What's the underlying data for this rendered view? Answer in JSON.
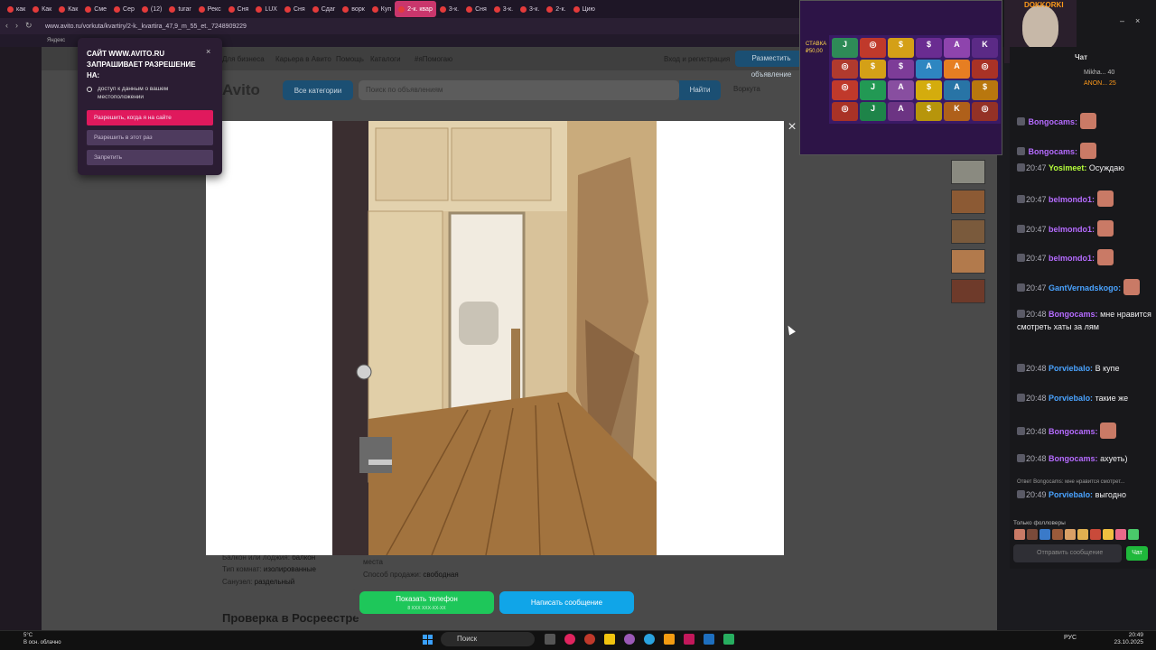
{
  "browser": {
    "tabs": [
      "как",
      "Как",
      "Как",
      "Сме",
      "Сер",
      "(12)",
      "turar",
      "Рекс",
      "Сня",
      "LUX",
      "Сня",
      "Сдаг",
      "ворк",
      "Куп",
      "2-к. квар",
      "3-к.",
      "Сня",
      "3-к.",
      "3-к.",
      "2-к.",
      "Цию"
    ],
    "active_tab_index": 14,
    "url": "www.avito.ru/vorkuta/kvartiry/2-k._kvartira_47,9_m_55_et._7248909229",
    "bookmark": "Яндекс"
  },
  "permission_popup": {
    "title": "САЙТ WWW.AVITO.RU ЗАПРАШИВАЕТ РАЗРЕШЕНИЕ НА:",
    "item": "доступ к данным о вашем местоположении",
    "allow_always": "Разрешить, когда я на сайте",
    "allow_once": "Разрешить в этот раз",
    "deny": "Запретить"
  },
  "avito": {
    "nav_business": "Для бизнеса",
    "nav_career": "Карьера в Авито",
    "nav_help": "Помощь",
    "nav_catalogs": "Каталоги",
    "nav_tag": "#яПомогаю",
    "login": "Вход и регистрация",
    "post_button": "Разместить объявление",
    "logo": "Avito",
    "categories_button": "Все категории",
    "search_placeholder": "Поиск по объявлениям",
    "find_button": "Найти",
    "city": "Воркута",
    "balcony_label": "Балкон или лоджия:",
    "balcony_value": "балкон",
    "rooms_type_label": "Тип комнат:",
    "rooms_type_value": "изолированные",
    "bathroom_label": "Санузел:",
    "bathroom_value": "раздельный",
    "places_label": "места",
    "sale_label": "Способ продажи:",
    "sale_value": "свободная",
    "section_title": "Проверка в Росреестре",
    "show_phone": "Показать телефон",
    "phone_sub": "8 XXX XXX-XX-XX",
    "write_message": "Написать сообщение"
  },
  "stream": {
    "streamer": "DOKKORKI",
    "chat_title": "Чат",
    "viewers": [
      {
        "name": "Mikha...",
        "count": "40"
      },
      {
        "name": "ANON...",
        "count": "25"
      }
    ],
    "slot_bet_label": "СТАВКА",
    "slot_bet_value": "₽50,00"
  },
  "chat": {
    "messages": [
      {
        "time": "",
        "user": "Bongocams:",
        "text": "",
        "ucolor": "violet"
      },
      {
        "time": "",
        "user": "Bongocams:",
        "text": "",
        "ucolor": "violet"
      },
      {
        "time": "20:47",
        "user": "Yosimeet:",
        "text": "Осуждаю",
        "ucolor": "green"
      },
      {
        "time": "20:47",
        "user": "belmondo1:",
        "text": "",
        "ucolor": "violet"
      },
      {
        "time": "20:47",
        "user": "belmondo1:",
        "text": "",
        "ucolor": "violet"
      },
      {
        "time": "20:47",
        "user": "belmondo1:",
        "text": "",
        "ucolor": "violet"
      },
      {
        "time": "20:47",
        "user": "GantVernadskogo:",
        "text": "",
        "ucolor": "blue"
      },
      {
        "time": "20:48",
        "user": "Bongocams:",
        "text": "мне нравится смотреть хаты за лям",
        "ucolor": "violet"
      },
      {
        "time": "20:48",
        "user": "Porviebalo:",
        "text": "В купе",
        "ucolor": "blue"
      },
      {
        "time": "20:48",
        "user": "Porviebalo:",
        "text": "такие же",
        "ucolor": "blue"
      },
      {
        "time": "20:48",
        "user": "Bongocams:",
        "text": "",
        "ucolor": "violet"
      },
      {
        "time": "20:48",
        "user": "Bongocams:",
        "text": "ахуеть)",
        "ucolor": "violet"
      },
      {
        "time": "20:49",
        "user": "Porviebalo:",
        "text": "выгодно",
        "ucolor": "blue"
      }
    ],
    "reply_hint": "Ответ Bongocams: мне нравится смотрет...",
    "followers_only": "Только фолловеры",
    "input_placeholder": "Отправить сообщение",
    "send": "Чат"
  },
  "taskbar": {
    "weather_temp": "5°C",
    "weather_desc": "В осн. облачно",
    "search": "Поиск",
    "lang": "РУС",
    "time": "20:49",
    "date": "23.10.2025"
  }
}
